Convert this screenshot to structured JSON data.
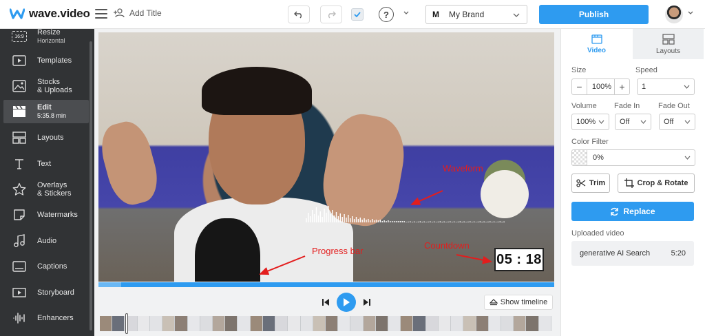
{
  "app": {
    "name": "wave.video",
    "brand_color": "#2e9bf0"
  },
  "header": {
    "add_title_label": "Add Title",
    "help_label": "?",
    "brand_prefix": "M",
    "brand_name": "My Brand",
    "publish_label": "Publish"
  },
  "sidebar": {
    "items": [
      {
        "label": "Resize",
        "sub": "Horizontal",
        "icon": "resize-icon"
      },
      {
        "label": "Templates",
        "sub": "",
        "icon": "templates-icon"
      },
      {
        "label": "Stocks",
        "sub": "& Uploads",
        "icon": "image-icon"
      },
      {
        "label": "Edit",
        "sub": "5:35.8 min",
        "icon": "clapperboard-icon"
      },
      {
        "label": "Layouts",
        "sub": "",
        "icon": "layouts-icon"
      },
      {
        "label": "Text",
        "sub": "",
        "icon": "text-icon"
      },
      {
        "label": "Overlays",
        "sub": "& Stickers",
        "icon": "star-icon"
      },
      {
        "label": "Watermarks",
        "sub": "",
        "icon": "watermark-icon"
      },
      {
        "label": "Audio",
        "sub": "",
        "icon": "music-icon"
      },
      {
        "label": "Captions",
        "sub": "",
        "icon": "captions-icon"
      },
      {
        "label": "Storyboard",
        "sub": "",
        "icon": "storyboard-icon"
      },
      {
        "label": "Enhancers",
        "sub": "",
        "icon": "waveform-icon"
      }
    ],
    "resize_badge": "16:9"
  },
  "player": {
    "annotations": {
      "waveform": "Waveform",
      "progress": "Progress bar",
      "countdown": "Countdown"
    },
    "countdown_value": "05 : 18",
    "progress_fraction": 0.05,
    "show_timeline_label": "Show timeline",
    "annotation_color": "#e31d1d"
  },
  "panel": {
    "tabs": [
      {
        "label": "Video"
      },
      {
        "label": "Layouts"
      }
    ],
    "size_label": "Size",
    "size_value": "100%",
    "speed_label": "Speed",
    "speed_value": "1",
    "volume_label": "Volume",
    "volume_value": "100%",
    "fade_in_label": "Fade In",
    "fade_in_value": "Off",
    "fade_out_label": "Fade Out",
    "fade_out_value": "Off",
    "color_filter_label": "Color Filter",
    "color_filter_value": "0%",
    "trim_label": "Trim",
    "crop_label": "Crop & Rotate",
    "replace_label": "Replace",
    "uploaded_label": "Uploaded video",
    "uploaded_name": "generative AI Search",
    "uploaded_duration": "5:20"
  }
}
